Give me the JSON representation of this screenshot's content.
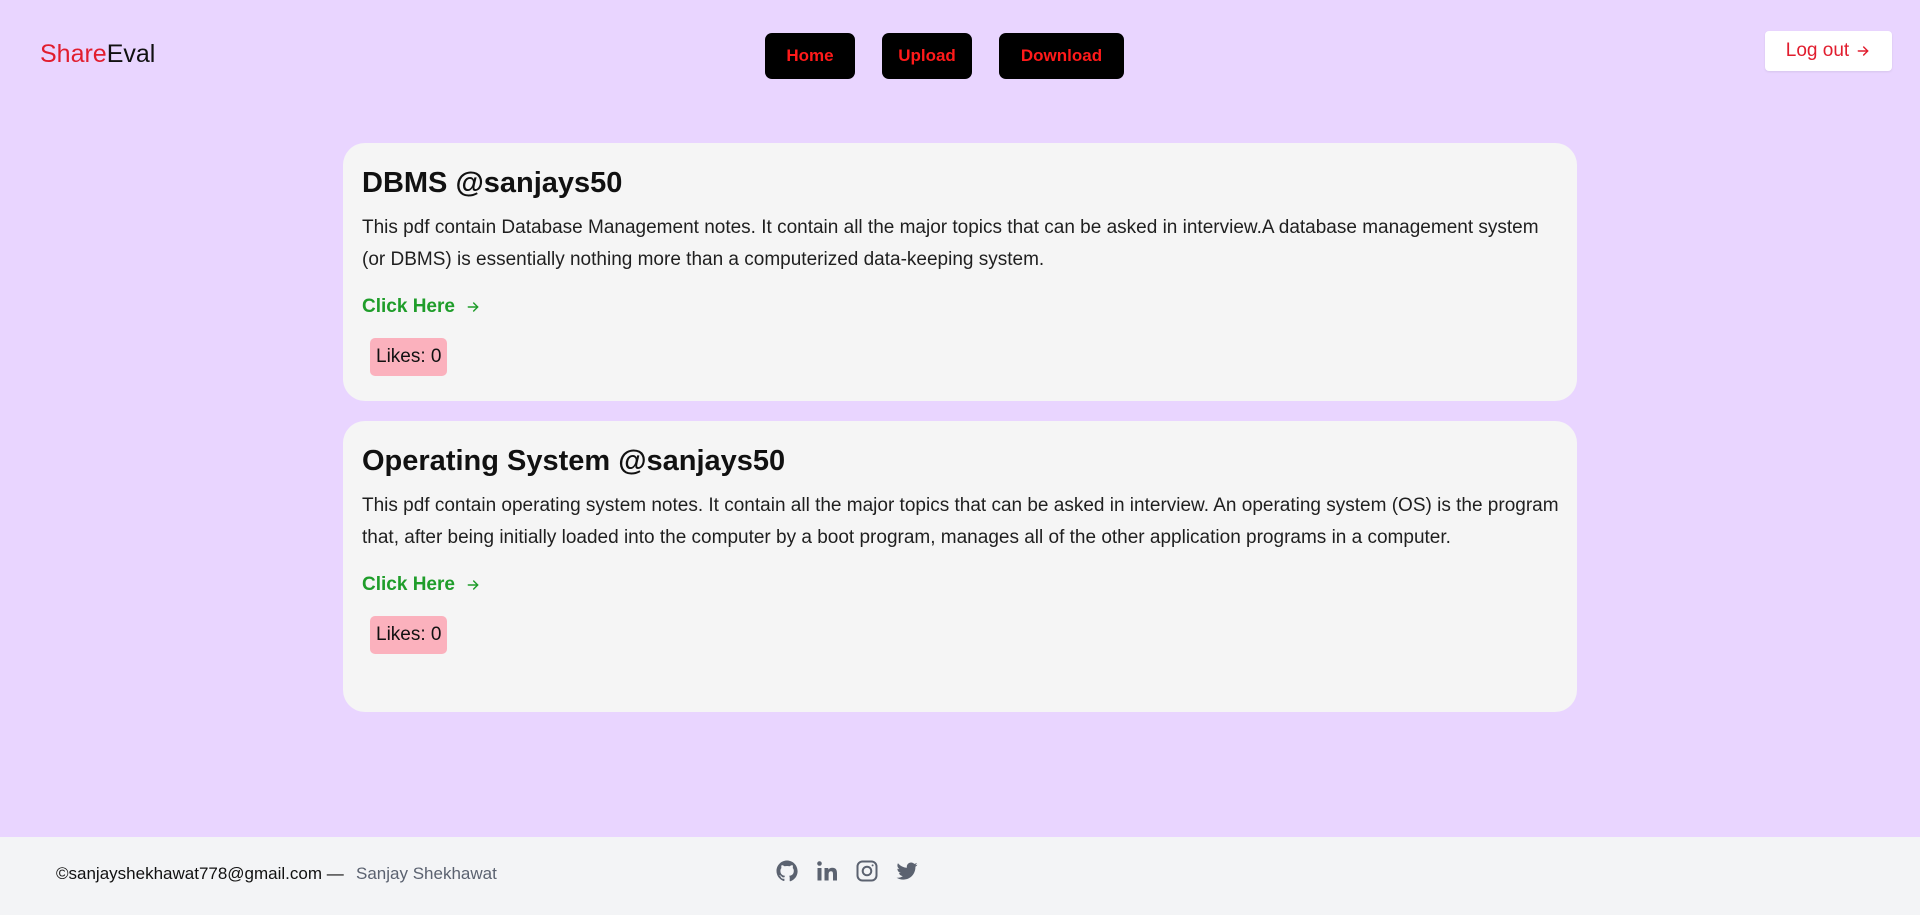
{
  "header": {
    "brand_part1": "Share",
    "brand_part2": "Eval",
    "nav": {
      "home": "Home",
      "upload": "Upload",
      "download": "Download"
    },
    "logout_label": "Log out",
    "logout_icon": "arrow-right-icon"
  },
  "cards": [
    {
      "title": "DBMS @sanjays50",
      "description": "This pdf contain Database Management notes. It contain all the major topics that can be asked in interview.A database management system (or DBMS) is essentially nothing more than a computerized data-keeping system.",
      "link_label": "Click Here",
      "likes_label": "Likes: 0"
    },
    {
      "title": "Operating System @sanjays50",
      "description": "This pdf contain operating system notes. It contain all the major topics that can be asked in interview. An operating system (OS) is the program that, after being initially loaded into the computer by a boot program, manages all of the other application programs in a computer.",
      "link_label": "Click Here",
      "likes_label": "Likes: 0"
    }
  ],
  "footer": {
    "email": "©sanjayshekhawat778@gmail.com —",
    "name": "Sanjay Shekhawat",
    "icons": [
      "github-icon",
      "linkedin-icon",
      "instagram-icon",
      "twitter-icon"
    ]
  },
  "colors": {
    "background": "#e9d5ff",
    "brand_red": "#e11d2e",
    "link_green": "#1f9d2a",
    "likes_pink": "#fbb1bd",
    "card_bg": "#f5f5f5",
    "footer_bg": "#f3f4f6"
  }
}
